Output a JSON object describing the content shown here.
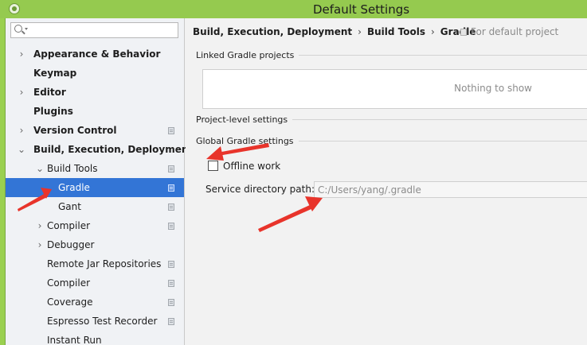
{
  "window": {
    "title": "Default Settings"
  },
  "sidebar": {
    "search": {
      "value": ""
    },
    "items": [
      {
        "label": "Appearance & Behavior",
        "arrow": "›",
        "bold": true,
        "indent": 0,
        "proj": false,
        "selected": false
      },
      {
        "label": "Keymap",
        "arrow": "",
        "bold": true,
        "indent": 0,
        "proj": false,
        "selected": false
      },
      {
        "label": "Editor",
        "arrow": "›",
        "bold": true,
        "indent": 0,
        "proj": false,
        "selected": false
      },
      {
        "label": "Plugins",
        "arrow": "",
        "bold": true,
        "indent": 0,
        "proj": false,
        "selected": false
      },
      {
        "label": "Version Control",
        "arrow": "›",
        "bold": true,
        "indent": 0,
        "proj": true,
        "selected": false
      },
      {
        "label": "Build, Execution, Deployment",
        "arrow": "⌄",
        "bold": true,
        "indent": 0,
        "proj": false,
        "selected": false
      },
      {
        "label": "Build Tools",
        "arrow": "⌄",
        "bold": false,
        "indent": 1,
        "proj": true,
        "selected": false
      },
      {
        "label": "Gradle",
        "arrow": "",
        "bold": false,
        "indent": 2,
        "proj": true,
        "selected": true
      },
      {
        "label": "Gant",
        "arrow": "",
        "bold": false,
        "indent": 2,
        "proj": true,
        "selected": false
      },
      {
        "label": "Compiler",
        "arrow": "›",
        "bold": false,
        "indent": 1,
        "proj": true,
        "selected": false
      },
      {
        "label": "Debugger",
        "arrow": "›",
        "bold": false,
        "indent": 1,
        "proj": false,
        "selected": false
      },
      {
        "label": "Remote Jar Repositories",
        "arrow": "",
        "bold": false,
        "indent": 1,
        "proj": true,
        "selected": false
      },
      {
        "label": "Compiler",
        "arrow": "",
        "bold": false,
        "indent": 1,
        "proj": true,
        "selected": false
      },
      {
        "label": "Coverage",
        "arrow": "",
        "bold": false,
        "indent": 1,
        "proj": true,
        "selected": false
      },
      {
        "label": "Espresso Test Recorder",
        "arrow": "",
        "bold": false,
        "indent": 1,
        "proj": true,
        "selected": false
      },
      {
        "label": "Instant Run",
        "arrow": "",
        "bold": false,
        "indent": 1,
        "proj": false,
        "selected": false
      }
    ]
  },
  "main": {
    "breadcrumb": [
      "Build, Execution, Deployment",
      "Build Tools",
      "Gradle"
    ],
    "breadcrumb_sep": "›",
    "scope_note": "For default project",
    "linked_projects": {
      "heading": "Linked Gradle projects",
      "empty_text": "Nothing to show"
    },
    "project_level": {
      "heading": "Project-level settings"
    },
    "global": {
      "heading": "Global Gradle settings",
      "offline_label": "Offline work",
      "offline_checked": false,
      "service_dir_label": "Service directory path:",
      "service_dir_value": "C:/Users/yang/.gradle"
    }
  },
  "colors": {
    "title_bar": "#95ca4f",
    "selection": "#3375d6",
    "annotation_arrow": "#e8342b"
  }
}
